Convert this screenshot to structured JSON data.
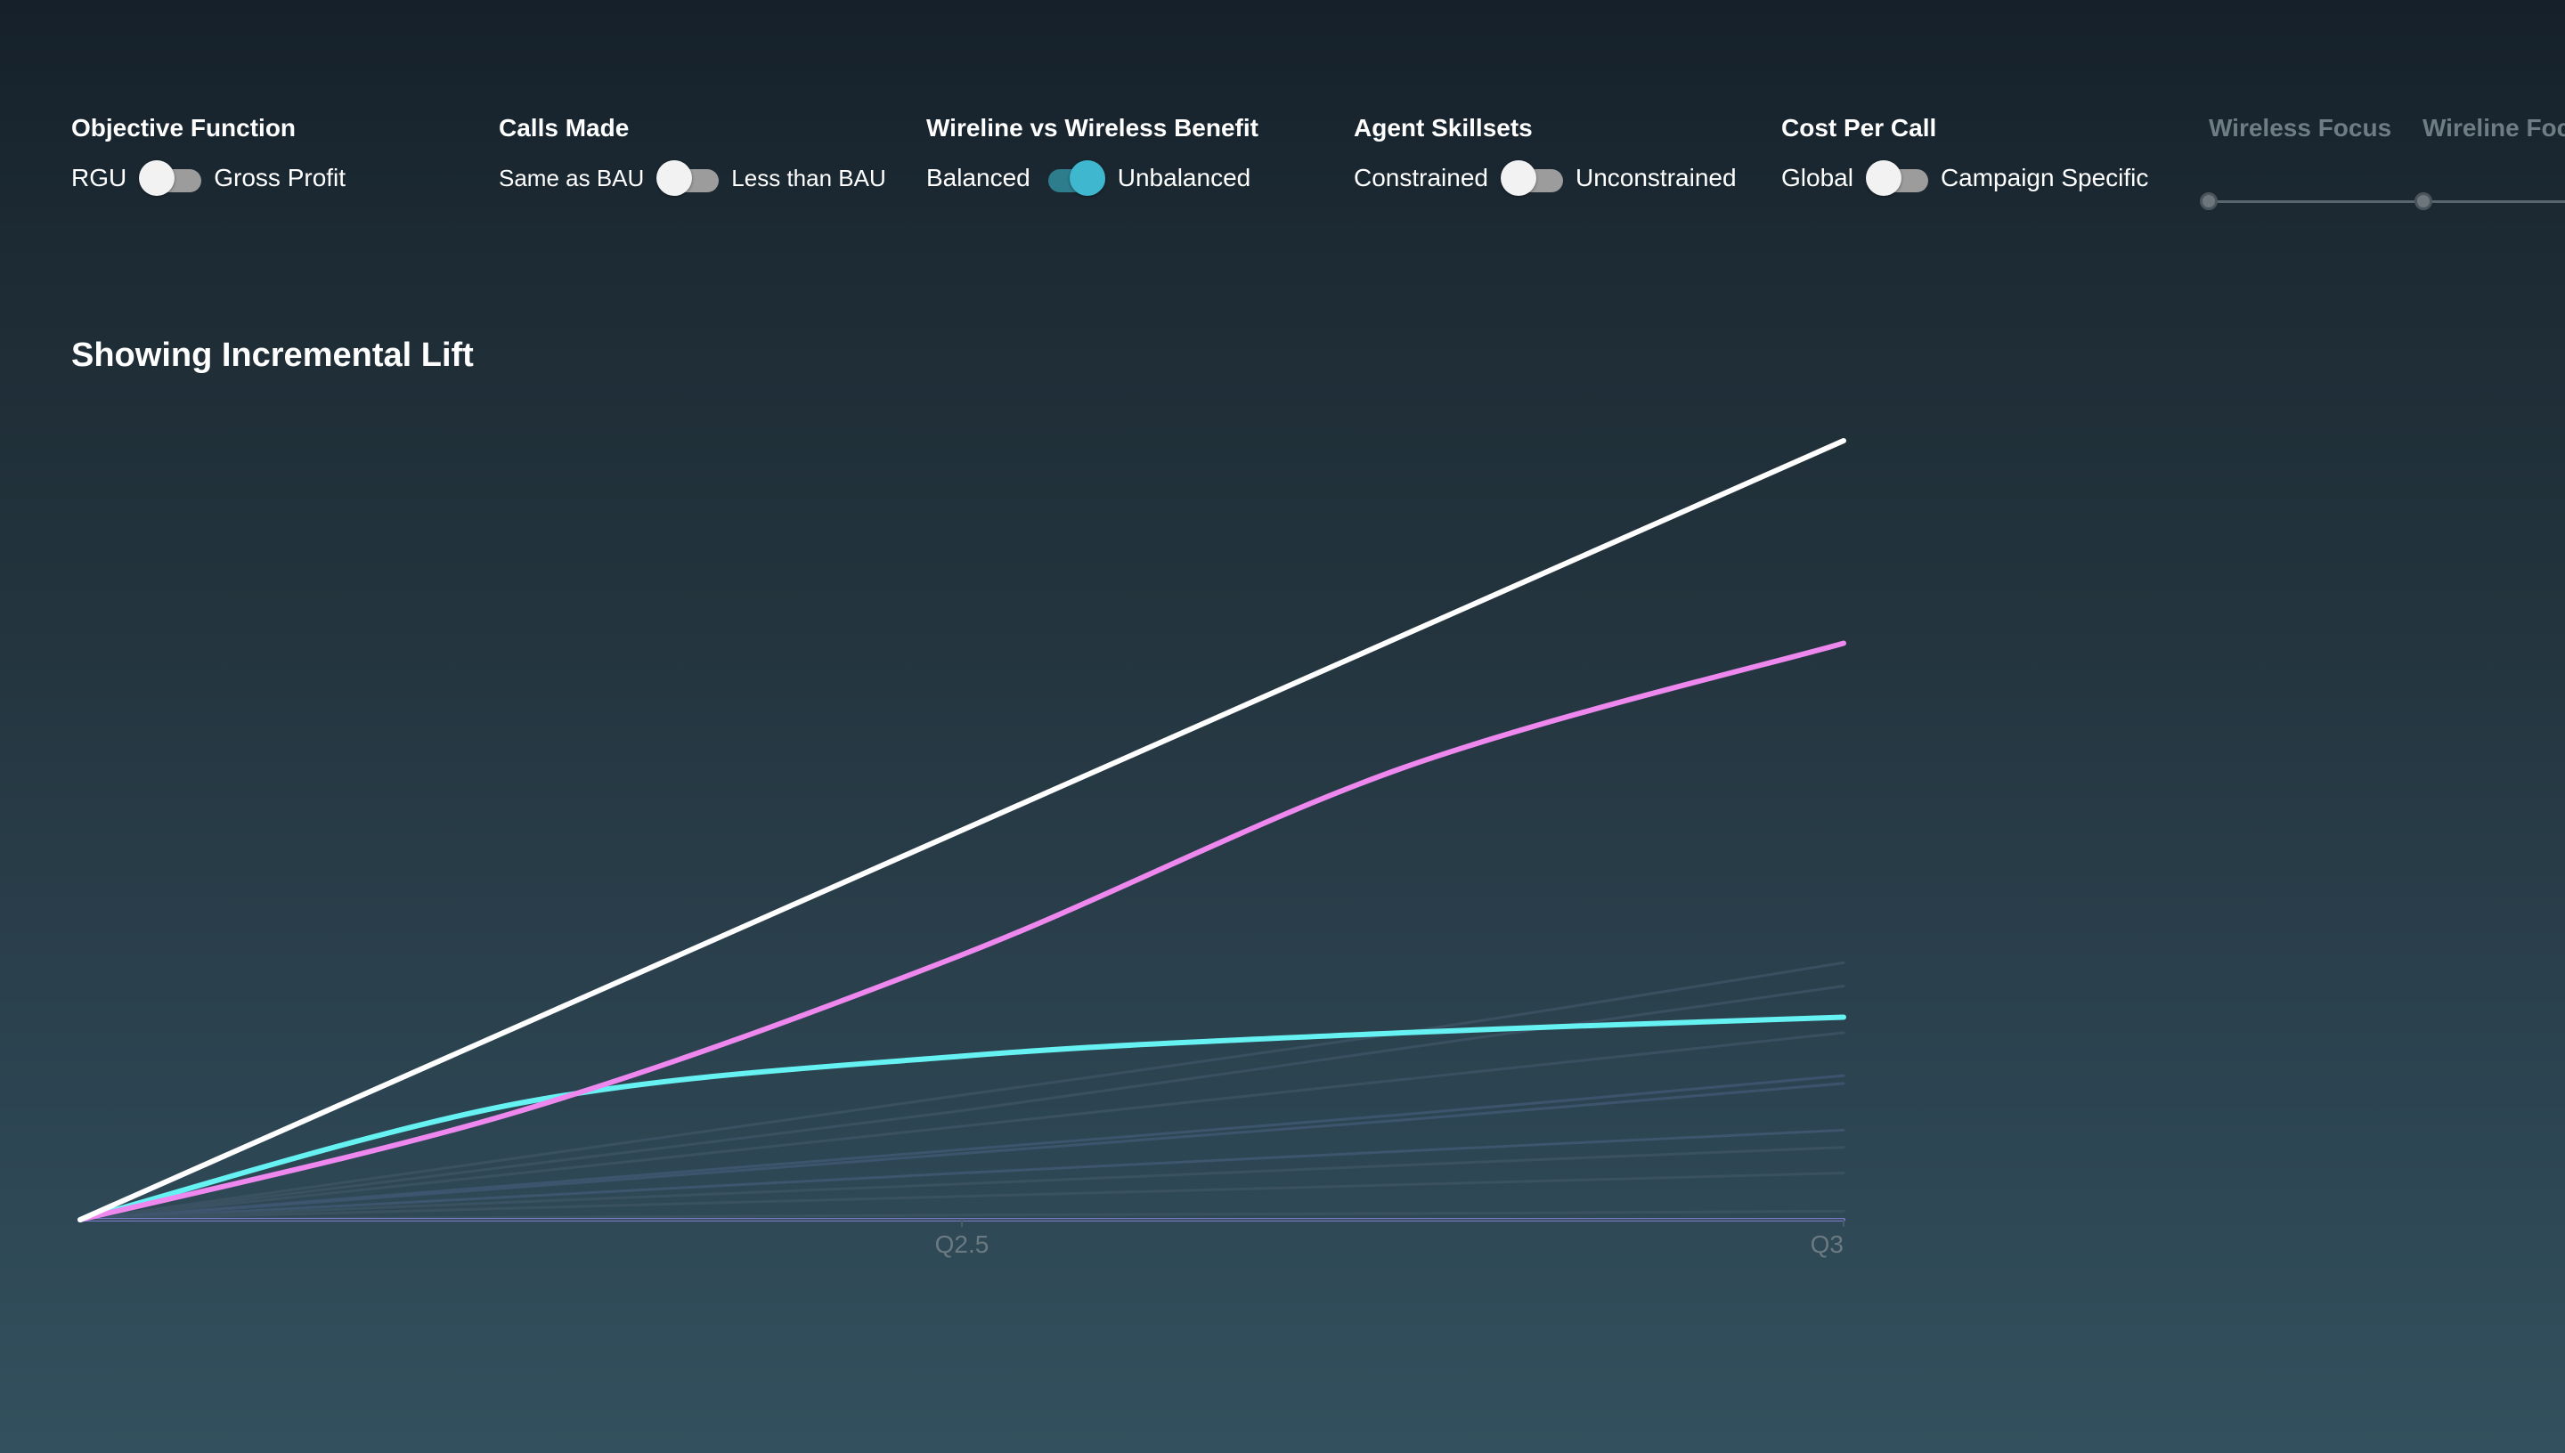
{
  "controls": [
    {
      "title": "Objective Function",
      "left": "RGU",
      "right": "Gross Profit",
      "state": "off"
    },
    {
      "title": "Calls Made",
      "left": "Same as BAU",
      "right": "Less than BAU",
      "state": "off"
    },
    {
      "title": "Wireline vs Wireless Benefit",
      "left": "Balanced",
      "right": "Unbalanced",
      "state": "on"
    },
    {
      "title": "Agent Skillsets",
      "left": "Constrained",
      "right": "Unconstrained",
      "state": "off"
    },
    {
      "title": "Cost Per Call",
      "left": "Global",
      "right": "Campaign Specific",
      "state": "off"
    }
  ],
  "faded_sliders": {
    "items": [
      "Wireless Focus",
      "Wireline Foc"
    ]
  },
  "chart_data": {
    "type": "line",
    "title": "Showing Incremental Lift",
    "x_ticks": [
      "Q2.5",
      "Q3"
    ],
    "x": [
      0,
      0.25,
      0.5,
      0.75,
      1.0
    ],
    "ylim": [
      0,
      100
    ],
    "series": [
      {
        "color": "#ffffff",
        "width": 6,
        "values": [
          0,
          25,
          50,
          75,
          100
        ]
      },
      {
        "color": "#ee88ee",
        "width": 6,
        "values": [
          0,
          14,
          34,
          58,
          74
        ]
      },
      {
        "color": "#66f2f2",
        "width": 6,
        "values": [
          0,
          15,
          21,
          24,
          26
        ]
      },
      {
        "color": "#3c5263",
        "width": 3,
        "values": [
          0,
          8,
          16,
          24,
          33
        ]
      },
      {
        "color": "#3c5263",
        "width": 3,
        "values": [
          0,
          7,
          14,
          22,
          30
        ]
      },
      {
        "color": "#3c5263",
        "width": 3,
        "values": [
          0,
          6,
          12,
          18,
          24
        ]
      },
      {
        "color": "#3f5570",
        "width": 3,
        "values": [
          0,
          4.5,
          9,
          13.5,
          18.5
        ]
      },
      {
        "color": "#3f5570",
        "width": 3,
        "values": [
          0,
          4.2,
          8.5,
          12.8,
          17.5
        ]
      },
      {
        "color": "#3f5670",
        "width": 3,
        "values": [
          0,
          3,
          6,
          8.8,
          11.5
        ]
      },
      {
        "color": "#3c5263",
        "width": 3,
        "values": [
          0,
          2.3,
          4.6,
          7,
          9.3
        ]
      },
      {
        "color": "#3c5263",
        "width": 3,
        "values": [
          0,
          1.5,
          3,
          4.5,
          6
        ]
      },
      {
        "color": "#3c5263",
        "width": 3,
        "values": [
          0,
          0.3,
          0.6,
          0.8,
          1.1
        ]
      },
      {
        "color": "#7f7fd8",
        "width": 4,
        "values": [
          0,
          0,
          0,
          0,
          0
        ]
      }
    ]
  }
}
